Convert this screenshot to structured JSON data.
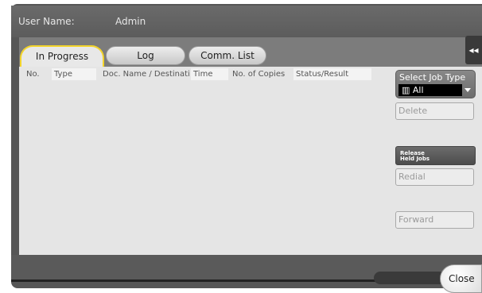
{
  "header": {
    "user_label": "User Name:",
    "user_value": "Admin"
  },
  "tabs": [
    {
      "label": "In Progress",
      "active": true
    },
    {
      "label": "Log",
      "active": false
    },
    {
      "label": "Comm. List",
      "active": false
    }
  ],
  "table": {
    "columns": [
      "No.",
      "Type",
      "Doc. Name / Destinati",
      "Time",
      "No. of Copies",
      "Status/Result"
    ]
  },
  "side_panel": {
    "select_job_type_label": "Select Job Type",
    "select_job_type_value": "All",
    "delete_label": "Delete",
    "release_line1": "Release",
    "release_line2": "Held Jobs",
    "redial_label": "Redial",
    "forward_label": "Forward"
  },
  "footer": {
    "close_label": "Close"
  },
  "colors": {
    "accent_tab_border": "#f3d42a",
    "frame": "#565656",
    "panel": "#e5e5e5"
  }
}
